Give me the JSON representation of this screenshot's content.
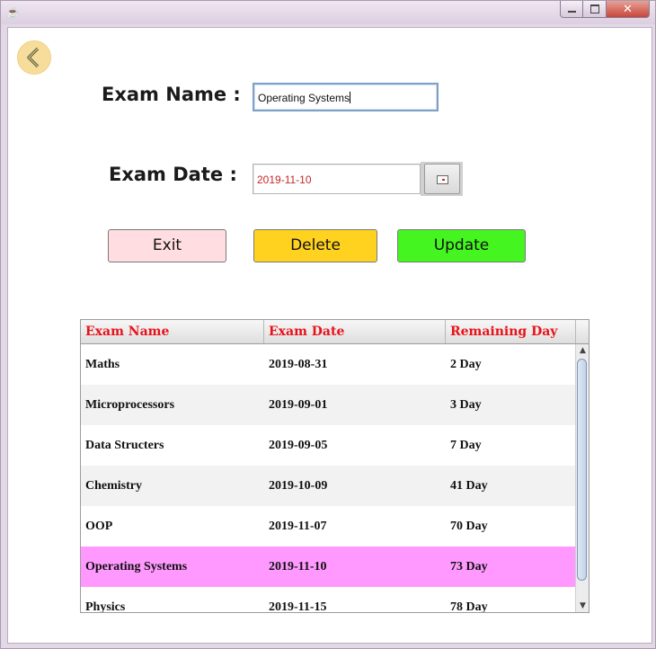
{
  "window": {
    "app_icon": "java-coffee-icon",
    "min_icon": "minimize-icon",
    "max_icon": "maximize-icon",
    "close_icon": "close-icon",
    "close_symbol": "✕"
  },
  "back_button": {
    "icon": "chevron-left-icon"
  },
  "form": {
    "exam_name_label": "Exam Name :",
    "exam_name_value": "Operating Systems",
    "exam_date_label": "Exam Date  :",
    "exam_date_value": "2019-11-10",
    "date_picker_icon": "calendar-icon"
  },
  "buttons": {
    "exit": "Exit",
    "delete": "Delete",
    "update": "Update"
  },
  "colors": {
    "header_text": "#e8121a",
    "selected_row": "#ff99ff",
    "delete_button": "#ffd21f",
    "update_button": "#45f520",
    "exit_button": "#ffdde0"
  },
  "table": {
    "columns": [
      "Exam Name",
      "Exam Date",
      "Remaining Day"
    ],
    "selected_row": 5,
    "rows": [
      [
        "Maths",
        "2019-08-31",
        "2 Day"
      ],
      [
        "Microprocessors",
        "2019-09-01",
        "3 Day"
      ],
      [
        "Data Structers",
        "2019-09-05",
        "7 Day"
      ],
      [
        "Chemistry",
        "2019-10-09",
        "41 Day"
      ],
      [
        "OOP",
        "2019-11-07",
        "70 Day"
      ],
      [
        "Operating Systems",
        "2019-11-10",
        "73 Day"
      ],
      [
        "Physics",
        "2019-11-15",
        "78 Day"
      ]
    ]
  }
}
